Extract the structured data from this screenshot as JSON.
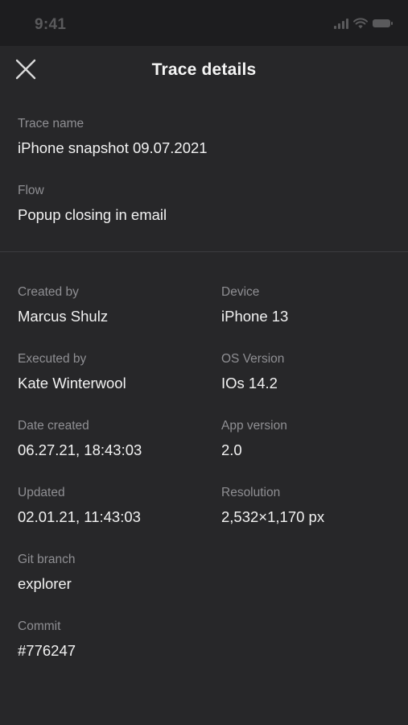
{
  "status_bar": {
    "time": "9:41"
  },
  "header": {
    "title": "Trace details"
  },
  "trace": {
    "name_label": "Trace name",
    "name_value": "iPhone snapshot 09.07.2021",
    "flow_label": "Flow",
    "flow_value": "Popup closing in email"
  },
  "details": {
    "created_by_label": "Created by",
    "created_by_value": "Marcus Shulz",
    "device_label": "Device",
    "device_value": "iPhone 13",
    "executed_by_label": "Executed by",
    "executed_by_value": "Kate Winterwool",
    "os_version_label": "OS Version",
    "os_version_value": "IOs 14.2",
    "date_created_label": "Date created",
    "date_created_value": "06.27.21, 18:43:03",
    "app_version_label": "App version",
    "app_version_value": "2.0",
    "updated_label": "Updated",
    "updated_value": "02.01.21, 11:43:03",
    "resolution_label": "Resolution",
    "resolution_value": "2,532×1,170 px",
    "git_branch_label": "Git branch",
    "git_branch_value": "explorer",
    "commit_label": "Commit",
    "commit_value": "#776247"
  }
}
